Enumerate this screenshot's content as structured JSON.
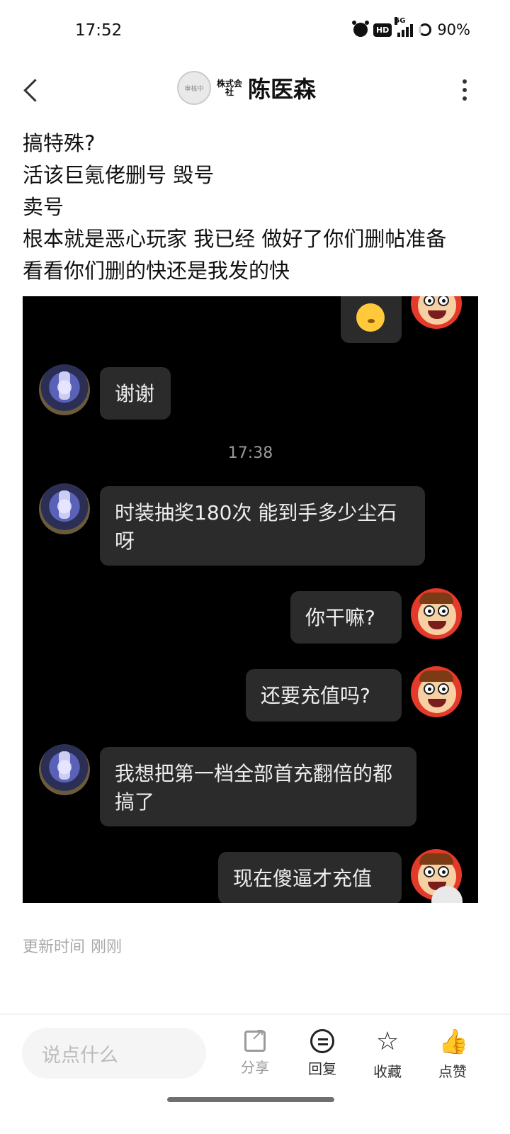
{
  "status_bar": {
    "time": "17:52",
    "network": "5G",
    "hd": "HD",
    "battery": "90%"
  },
  "header": {
    "avatar_badge": "审核中",
    "name_prefix": "株式会社",
    "name": "陈医森"
  },
  "post": {
    "lines": [
      "搞特殊?",
      "活该巨氪佬删号 毁号",
      "卖号",
      "根本就是恶心玩家 我已经 做好了你们删帖准备",
      "看看你们删的快还是我发的快"
    ]
  },
  "chat_screenshot": {
    "messages": [
      {
        "side": "right",
        "type": "emoji",
        "text": ""
      },
      {
        "side": "left",
        "text": "谢谢"
      },
      {
        "type": "timestamp",
        "text": "17:38"
      },
      {
        "side": "left",
        "text": "时装抽奖180次  能到手多少尘石呀"
      },
      {
        "side": "right",
        "text": "你干嘛?"
      },
      {
        "side": "right",
        "text": "还要充值吗?"
      },
      {
        "side": "left",
        "text": "我想把第一档全部首充翻倍的都搞了"
      },
      {
        "side": "right",
        "text": "现在傻逼才充值"
      }
    ]
  },
  "meta": {
    "updated_label": "更新时间",
    "updated_value": "刚刚"
  },
  "bottom_bar": {
    "comment_placeholder": "说点什么",
    "share": "分享",
    "reply": "回复",
    "favorite": "收藏",
    "like": "点赞"
  }
}
